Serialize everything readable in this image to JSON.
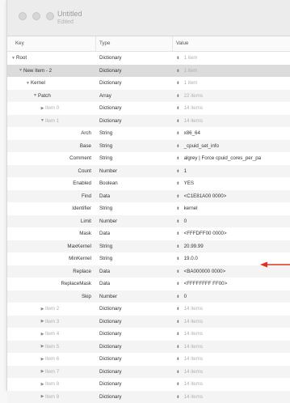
{
  "window": {
    "title": "Untitled",
    "subtitle": "Edited",
    "traffic_lights": [
      "close",
      "minimize",
      "zoom"
    ]
  },
  "columns": {
    "key": "Key",
    "type": "Type",
    "value": "Value"
  },
  "rows": [
    {
      "key": "Root",
      "type": "Dictionary",
      "value": "1 item",
      "indent": 0,
      "disclosure": "open",
      "muted_value": true
    },
    {
      "key": "New Item - 2",
      "type": "Dictionary",
      "value": "1 item",
      "indent": 1,
      "disclosure": "open",
      "muted_value": true,
      "selected": true
    },
    {
      "key": "Kernel",
      "type": "Dictionary",
      "value": "1 item",
      "indent": 2,
      "disclosure": "open",
      "muted_value": true
    },
    {
      "key": "Patch",
      "type": "Array",
      "value": "22 items",
      "indent": 3,
      "disclosure": "open",
      "muted_value": true
    },
    {
      "key": "Item 0",
      "type": "Dictionary",
      "value": "14 items",
      "indent": 4,
      "disclosure": "closed",
      "muted_key": true,
      "muted_value": true
    },
    {
      "key": "Item 1",
      "type": "Dictionary",
      "value": "14 items",
      "indent": 4,
      "disclosure": "open",
      "muted_key": true,
      "muted_value": true
    },
    {
      "key": "Arch",
      "type": "String",
      "value": "x86_64",
      "indent": 5,
      "leaf": true
    },
    {
      "key": "Base",
      "type": "String",
      "value": "_cpuid_set_info",
      "indent": 5,
      "leaf": true
    },
    {
      "key": "Comment",
      "type": "String",
      "value": "algrey | Force cpuid_cores_per_pa",
      "indent": 5,
      "leaf": true
    },
    {
      "key": "Count",
      "type": "Number",
      "value": "1",
      "indent": 5,
      "leaf": true
    },
    {
      "key": "Enabled",
      "type": "Boolean",
      "value": "YES",
      "indent": 5,
      "leaf": true
    },
    {
      "key": "Find",
      "type": "Data",
      "value": "<C1E81A00 0000>",
      "indent": 5,
      "leaf": true
    },
    {
      "key": "Identifier",
      "type": "String",
      "value": "kernel",
      "indent": 5,
      "leaf": true
    },
    {
      "key": "Limit",
      "type": "Number",
      "value": "0",
      "indent": 5,
      "leaf": true
    },
    {
      "key": "Mask",
      "type": "Data",
      "value": "<FFFDFF00 0000>",
      "indent": 5,
      "leaf": true
    },
    {
      "key": "MaxKernel",
      "type": "String",
      "value": "20.99.99",
      "indent": 5,
      "leaf": true
    },
    {
      "key": "MinKernel",
      "type": "String",
      "value": "19.0.0",
      "indent": 5,
      "leaf": true
    },
    {
      "key": "Replace",
      "type": "Data",
      "value": "<BA000000 0000>",
      "indent": 5,
      "leaf": true,
      "annotated": true
    },
    {
      "key": "ReplaceMask",
      "type": "Data",
      "value": "<FFFFFFFF FF00>",
      "indent": 5,
      "leaf": true
    },
    {
      "key": "Skip",
      "type": "Number",
      "value": "0",
      "indent": 5,
      "leaf": true
    },
    {
      "key": "Item 2",
      "type": "Dictionary",
      "value": "14 items",
      "indent": 4,
      "disclosure": "closed",
      "muted_key": true,
      "muted_value": true
    },
    {
      "key": "Item 3",
      "type": "Dictionary",
      "value": "14 items",
      "indent": 4,
      "disclosure": "closed",
      "muted_key": true,
      "muted_value": true
    },
    {
      "key": "Item 4",
      "type": "Dictionary",
      "value": "14 items",
      "indent": 4,
      "disclosure": "closed",
      "muted_key": true,
      "muted_value": true
    },
    {
      "key": "Item 5",
      "type": "Dictionary",
      "value": "14 items",
      "indent": 4,
      "disclosure": "closed",
      "muted_key": true,
      "muted_value": true
    },
    {
      "key": "Item 6",
      "type": "Dictionary",
      "value": "14 items",
      "indent": 4,
      "disclosure": "closed",
      "muted_key": true,
      "muted_value": true
    },
    {
      "key": "Item 7",
      "type": "Dictionary",
      "value": "14 items",
      "indent": 4,
      "disclosure": "closed",
      "muted_key": true,
      "muted_value": true
    },
    {
      "key": "Item 8",
      "type": "Dictionary",
      "value": "14 items",
      "indent": 4,
      "disclosure": "closed",
      "muted_key": true,
      "muted_value": true
    },
    {
      "key": "Item 9",
      "type": "Dictionary",
      "value": "14 items",
      "indent": 4,
      "disclosure": "closed",
      "muted_key": true,
      "muted_value": true
    }
  ],
  "annotation": {
    "color": "#e0301e",
    "icon": "red-arrow-left"
  }
}
